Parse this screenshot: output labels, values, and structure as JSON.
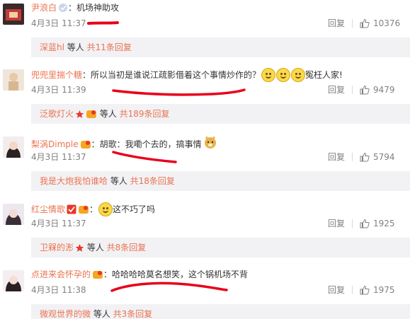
{
  "comments": [
    {
      "username": "尹浪白",
      "text": "：机场神助攻",
      "date": "4月3日 11:37",
      "reply_label": "回复",
      "likes": "10376",
      "sub": {
        "name": "深蓝hl",
        "tail": " 等人 ",
        "count": "共11条回复"
      }
    },
    {
      "username": "兜兜里揣个糖",
      "text": "：所以当初是谁说江疏影借着这个事情炒作的？",
      "text2": "冤枉人家!",
      "date": "4月3日 11:39",
      "reply_label": "回复",
      "likes": "9479",
      "sub": {
        "name": "泛歌灯火",
        "tail": " 等人 ",
        "count": "共189条回复"
      }
    },
    {
      "username": "梨涡Dimple",
      "text": "：胡歌：我嘞个去的，搞事情",
      "date": "4月3日 11:37",
      "reply_label": "回复",
      "likes": "5794",
      "sub": {
        "name": "我是大炮我怕谁哈",
        "tail": " 等人 ",
        "count": "共18条回复"
      }
    },
    {
      "username": "红尘情歌",
      "text": "这不巧了吗",
      "date": "4月3日 11:37",
      "reply_label": "回复",
      "likes": "1925",
      "sub": {
        "name": "卫槑的浵",
        "tail": " 等人 ",
        "count": "共8条回复"
      }
    },
    {
      "username": "点进来会怀孕的",
      "text": "：哈哈哈哈莫名想笑，这个锅机场不背",
      "date": "4月3日 11:38",
      "reply_label": "回复",
      "likes": "1975",
      "sub": {
        "name": "微观世界的微",
        "tail": " 等人 ",
        "count": "共3条回复"
      }
    }
  ],
  "colors": {
    "username": "#eb7350",
    "meta": "#808080",
    "subbox": "#f2f2f5",
    "annotation": "#e8001c"
  }
}
